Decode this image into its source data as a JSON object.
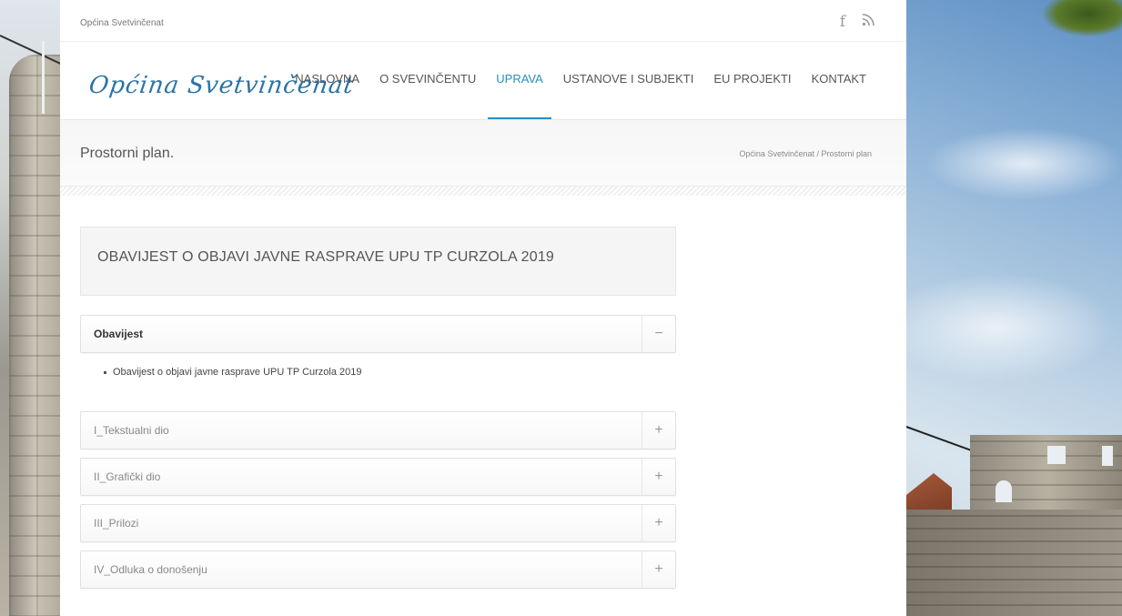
{
  "topbar": {
    "site_name": "Općina Svetvinčenat",
    "social": [
      {
        "icon": "facebook-icon",
        "glyph": "f"
      },
      {
        "icon": "rss-icon",
        "glyph": "⌇"
      }
    ]
  },
  "header": {
    "logo_text": "Općina Svetvinčenat",
    "nav": [
      {
        "label": "NASLOVNA",
        "active": false
      },
      {
        "label": "O SVEVINČENTU",
        "active": false
      },
      {
        "label": "UPRAVA",
        "active": true
      },
      {
        "label": "USTANOVE I SUBJEKTI",
        "active": false
      },
      {
        "label": "EU PROJEKTI",
        "active": false
      },
      {
        "label": "KONTAKT",
        "active": false
      }
    ],
    "accent_color": "#2a8fc0"
  },
  "titlebar": {
    "page_title": "Prostorni plan.",
    "breadcrumb": "Općina Svetvinčenat / Prostorni plan"
  },
  "main": {
    "notice_title": "OBAVIJEST O OBJAVI JAVNE RASPRAVE UPU TP CURZOLA 2019",
    "accordion": [
      {
        "label": "Obavijest",
        "open": true,
        "toggle": "−",
        "items": [
          "Obavijest o objavi javne rasprave UPU TP Curzola 2019"
        ]
      },
      {
        "label": "I_Tekstualni dio",
        "open": false,
        "toggle": "+"
      },
      {
        "label": "II_Grafički dio",
        "open": false,
        "toggle": "+"
      },
      {
        "label": "III_Prilozi",
        "open": false,
        "toggle": "+"
      },
      {
        "label": "IV_Odluka o donošenju",
        "open": false,
        "toggle": "+"
      }
    ]
  }
}
